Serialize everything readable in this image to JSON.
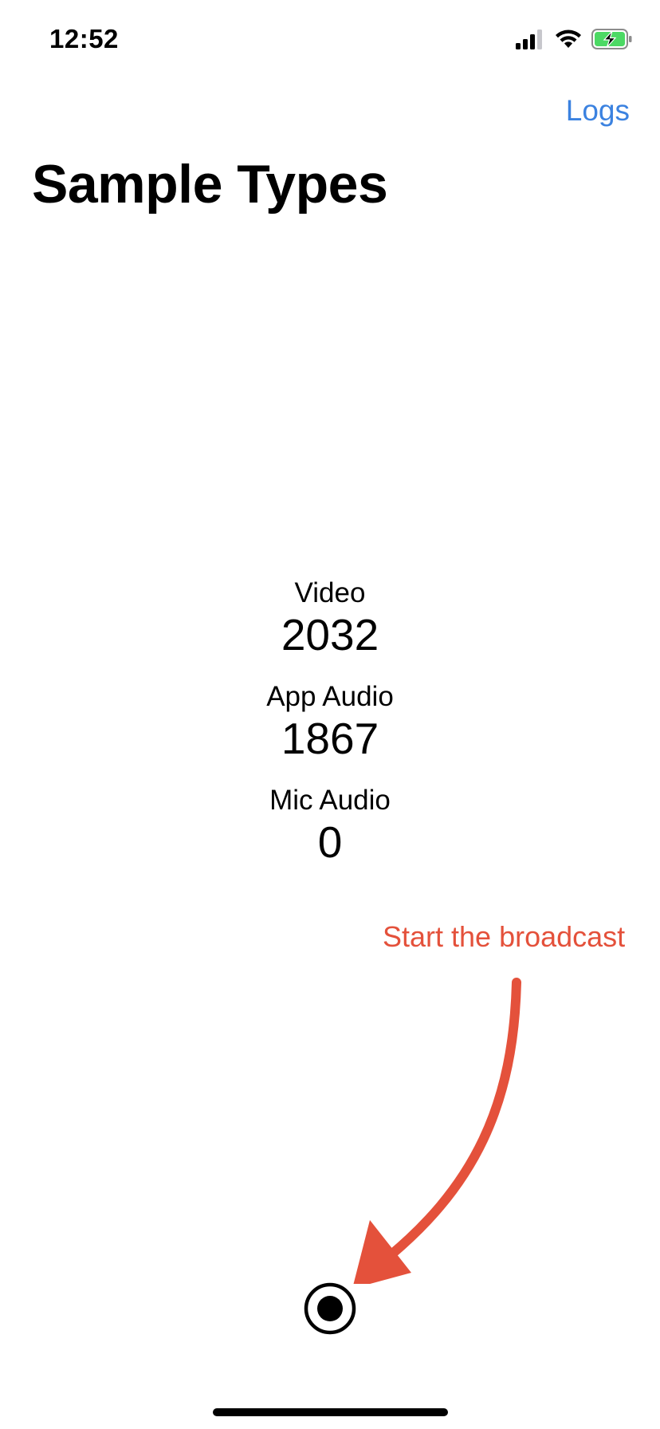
{
  "status_bar": {
    "time": "12:52",
    "icons": [
      "cellular-signal-icon",
      "wifi-icon",
      "battery-charging-icon"
    ],
    "battery_color": "#4cd964"
  },
  "nav": {
    "logs_label": "Logs",
    "accent_color": "#3b82e0"
  },
  "page": {
    "title": "Sample Types"
  },
  "stats": [
    {
      "label": "Video",
      "value": "2032"
    },
    {
      "label": "App Audio",
      "value": "1867"
    },
    {
      "label": "Mic Audio",
      "value": "0"
    }
  ],
  "annotation": {
    "text": "Start the broadcast",
    "color": "#e4513b"
  },
  "record_button": {
    "icon": "record-icon"
  }
}
